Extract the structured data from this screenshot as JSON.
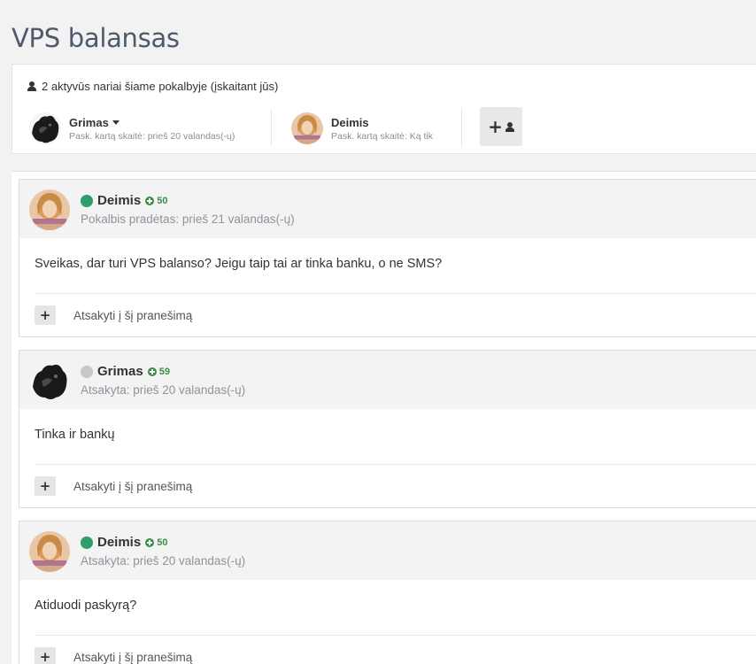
{
  "page": {
    "title": "VPS balansas"
  },
  "members": {
    "summary": "2 aktyvūs nariai šiame pokalbyje (įskaitant jūs)",
    "list": [
      {
        "name": "Grimas",
        "sub": "Pask. kartą skaitė: prieš 20 valandas(-ų)",
        "avatar": "avatar-grimas-icon"
      },
      {
        "name": "Deimis",
        "sub": "Pask. kartą skaitė: Ką tik",
        "avatar": "avatar-deimis-icon"
      }
    ],
    "add_button_icon": "add-member-icon"
  },
  "posts": [
    {
      "author": "Deimis",
      "online": true,
      "reputation": "50",
      "meta": "Pokalbis pradėtas: prieš 21 valandas(-ų)",
      "body": "Sveikas, dar turi VPS balanso? Jeigu taip tai ar tinka banku, o ne SMS?",
      "reply_label": "Atsakyti į šį pranešimą"
    },
    {
      "author": "Grimas",
      "online": false,
      "reputation": "59",
      "meta": "Atsakyta: prieš 20 valandas(-ų)",
      "body": "Tinka ir bankų",
      "reply_label": "Atsakyti į šį pranešimą"
    },
    {
      "author": "Deimis",
      "online": true,
      "reputation": "50",
      "meta": "Atsakyta: prieš 20 valandas(-ų)",
      "body": "Atiduodi paskyrą?",
      "reply_label": "Atsakyti į šį pranešimą"
    }
  ],
  "colors": {
    "online": "#2e9e6b",
    "offline": "#c8c8c8",
    "reputation": "#3b8f47",
    "title": "#4d5a6b"
  }
}
